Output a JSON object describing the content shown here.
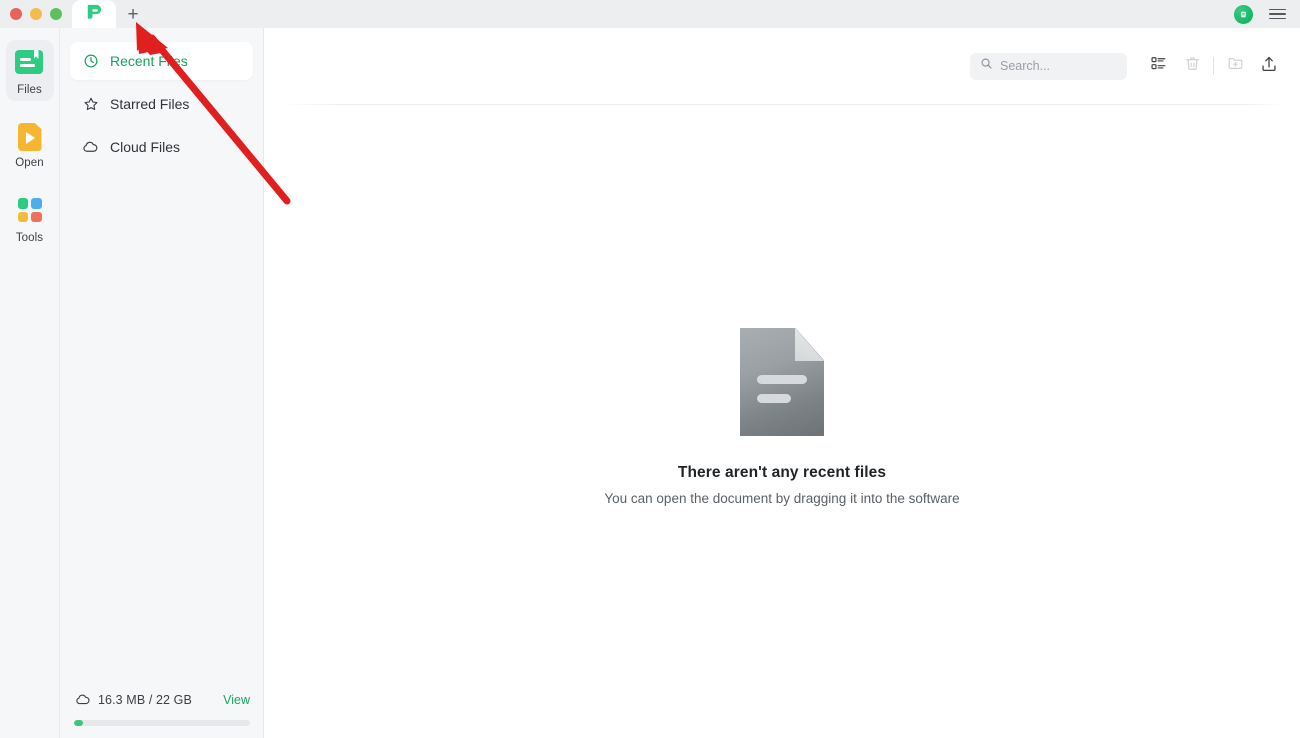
{
  "window": {
    "traffic_lights": [
      {
        "name": "close",
        "color": "#e9635d"
      },
      {
        "name": "minimize",
        "color": "#f2bc4e"
      },
      {
        "name": "maximize",
        "color": "#5ec15e"
      }
    ],
    "tab_logo_icon": "app-logo-icon",
    "new_tab_label": "+",
    "avatar_icon": "user-avatar-icon",
    "menu_icon": "hamburger-menu-icon"
  },
  "rail": {
    "items": [
      {
        "label": "Files",
        "icon": "files-icon",
        "active": true
      },
      {
        "label": "Open",
        "icon": "open-icon",
        "active": false
      },
      {
        "label": "Tools",
        "icon": "tools-icon",
        "active": false
      }
    ],
    "tools_colors": [
      "#2ecc82",
      "#4aaef0",
      "#f5bb3f",
      "#f0705e"
    ]
  },
  "sidebar": {
    "items": [
      {
        "label": "Recent Files",
        "icon": "clock-icon",
        "active": true
      },
      {
        "label": "Starred Files",
        "icon": "star-icon",
        "active": false
      },
      {
        "label": "Cloud Files",
        "icon": "cloud-icon",
        "active": false
      }
    ],
    "storage": {
      "icon": "cloud-icon",
      "usage_text": "16.3 MB / 22 GB",
      "view_label": "View",
      "percent": 5
    }
  },
  "toolbar": {
    "search": {
      "placeholder": "Search...",
      "value": "",
      "icon": "search-icon"
    },
    "buttons": [
      {
        "name": "list-view-button",
        "icon": "list-view-icon",
        "enabled": true
      },
      {
        "name": "delete-button",
        "icon": "trash-icon",
        "enabled": false
      },
      {
        "name": "new-folder-button",
        "icon": "new-folder-icon",
        "enabled": false
      },
      {
        "name": "upload-button",
        "icon": "upload-icon",
        "enabled": true
      }
    ]
  },
  "empty_state": {
    "illustration": "document-icon",
    "title": "There aren't any recent files",
    "subtitle": "You can open the document by dragging it into the software"
  },
  "annotation": {
    "arrow_color": "#e01f1f",
    "points_to": "new-tab-button"
  },
  "colors": {
    "accent_green": "#14a45e",
    "titlebar_bg": "#eceef0",
    "panel_bg": "#f6f7f9",
    "content_bg": "#ffffff"
  }
}
